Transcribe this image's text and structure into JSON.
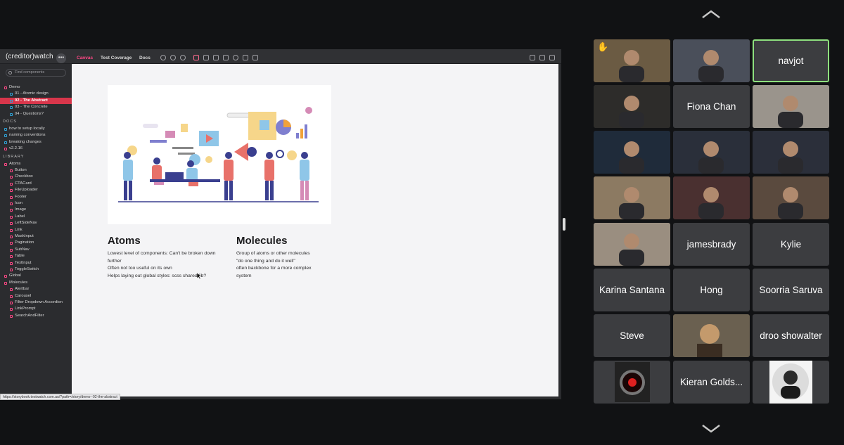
{
  "nav": {
    "up_label": "scroll up",
    "down_label": "scroll down"
  },
  "storybook": {
    "brand": "(creditor)watch",
    "tabs": [
      "Canvas",
      "Test Coverage",
      "Docs"
    ],
    "search_placeholder": "Find components",
    "demo_group": "Demo",
    "demo_items": [
      "01 - Atomic design",
      "02 - The Abstract",
      "03 - The Concrete",
      "04 - Questions?"
    ],
    "docs_header": "DOCS",
    "docs_items": [
      "how to setup locally",
      "naming conventions",
      "breaking changes",
      "v2.2.16"
    ],
    "library_header": "LIBRARY",
    "atoms_label": "Atoms",
    "atoms": [
      "Button",
      "Checkbox",
      "CTACard",
      "FileUploader",
      "Footer",
      "Icon",
      "Image",
      "Label",
      "LeftSideNav",
      "Link",
      "MaskInput",
      "Pagination",
      "SubNav",
      "Table",
      "TextInput",
      "ToggleSwitch"
    ],
    "global_label": "Global",
    "molecules_label": "Molecules",
    "molecules": [
      "Alertbar",
      "Carousel",
      "Filter Dropdown Accordion",
      "LinkPrompt",
      "SearchAndFilter"
    ],
    "url": "https://storybook.testwatch.com.au/?path=/story/demo--02-the-abstract"
  },
  "content": {
    "atoms_title": "Atoms",
    "atoms_lines": [
      "Lowest level of components: Can't be broken down",
      "further",
      "Often not too useful on its own",
      "Helps laying out global styles: scss shared lib?"
    ],
    "molecules_title": "Molecules",
    "molecules_lines": [
      "Group of atoms or other molecules",
      "\"do one thing and do it well\"",
      "often backbone for a more complex",
      "system"
    ]
  },
  "participants": [
    {
      "name": "",
      "video": true,
      "emoji": "✋"
    },
    {
      "name": "",
      "video": true
    },
    {
      "name": "navjot",
      "video": false,
      "speaking": true
    },
    {
      "name": "",
      "video": true
    },
    {
      "name": "Fiona Chan",
      "video": false
    },
    {
      "name": "",
      "video": true
    },
    {
      "name": "",
      "video": true
    },
    {
      "name": "",
      "video": true
    },
    {
      "name": "",
      "video": true
    },
    {
      "name": "",
      "video": true
    },
    {
      "name": "",
      "video": true
    },
    {
      "name": "",
      "video": true
    },
    {
      "name": "",
      "video": true
    },
    {
      "name": "jamesbrady",
      "video": false
    },
    {
      "name": "Kylie",
      "video": false
    },
    {
      "name": "Karina Santana",
      "video": false
    },
    {
      "name": "Hong",
      "video": false
    },
    {
      "name": "Soorria Saruva",
      "video": false
    },
    {
      "name": "Steve",
      "video": false
    },
    {
      "name": "",
      "video": true
    },
    {
      "name": "droo showalter",
      "video": false
    },
    {
      "name": "",
      "video": true
    },
    {
      "name": "Kieran Golds...",
      "video": false
    },
    {
      "name": "",
      "video": true
    }
  ]
}
